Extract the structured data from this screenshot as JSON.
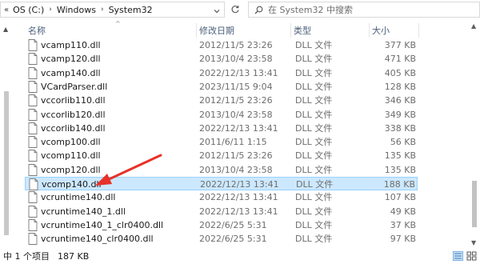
{
  "address": {
    "more_glyph": "«",
    "crumbs": [
      "OS (C:)",
      "Windows",
      "System32"
    ],
    "separator": "›"
  },
  "search": {
    "placeholder": "在 System32 中搜索"
  },
  "columns": {
    "name": "名称",
    "date": "修改日期",
    "type": "类型",
    "size": "大小"
  },
  "files": [
    {
      "name": "vcamp110.dll",
      "date": "2012/11/5 23:26",
      "type": "DLL 文件",
      "size": "377 KB"
    },
    {
      "name": "vcamp120.dll",
      "date": "2013/10/4 23:58",
      "type": "DLL 文件",
      "size": "471 KB"
    },
    {
      "name": "vcamp140.dll",
      "date": "2022/12/13 13:41",
      "type": "DLL 文件",
      "size": "405 KB"
    },
    {
      "name": "VCardParser.dll",
      "date": "2023/11/15 9:04",
      "type": "DLL 文件",
      "size": "128 KB"
    },
    {
      "name": "vccorlib110.dll",
      "date": "2012/11/5 23:26",
      "type": "DLL 文件",
      "size": "346 KB"
    },
    {
      "name": "vccorlib120.dll",
      "date": "2013/10/4 23:58",
      "type": "DLL 文件",
      "size": "349 KB"
    },
    {
      "name": "vccorlib140.dll",
      "date": "2022/12/13 13:41",
      "type": "DLL 文件",
      "size": "338 KB"
    },
    {
      "name": "vcomp100.dll",
      "date": "2011/6/11 1:15",
      "type": "DLL 文件",
      "size": "56 KB"
    },
    {
      "name": "vcomp110.dll",
      "date": "2012/11/5 23:26",
      "type": "DLL 文件",
      "size": "135 KB"
    },
    {
      "name": "vcomp120.dll",
      "date": "2013/10/4 23:58",
      "type": "DLL 文件",
      "size": "135 KB"
    },
    {
      "name": "vcomp140.dll",
      "date": "2022/12/13 13:41",
      "type": "DLL 文件",
      "size": "188 KB"
    },
    {
      "name": "vcruntime140.dll",
      "date": "2022/12/13 13:41",
      "type": "DLL 文件",
      "size": "107 KB"
    },
    {
      "name": "vcruntime140_1.dll",
      "date": "2022/12/13 13:41",
      "type": "DLL 文件",
      "size": "49 KB"
    },
    {
      "name": "vcruntime140_1_clr0400.dll",
      "date": "2022/6/25 5:31",
      "type": "DLL 文件",
      "size": "37 KB"
    },
    {
      "name": "vcruntime140_clr0400.dll",
      "date": "2022/6/25 5:31",
      "type": "DLL 文件",
      "size": "97 KB"
    }
  ],
  "selected_index": 10,
  "status": {
    "count": "中 1 个项目",
    "size": "187 KB"
  },
  "colors": {
    "selected_bg": "#cce8ff",
    "selected_border": "#99d1ff",
    "header_text": "#4c607a",
    "annotation_arrow": "#e8322a"
  },
  "icons": {
    "refresh": "refresh-icon",
    "search": "search-icon",
    "file": "dll-file-icon",
    "details_view": "details-view-icon",
    "tiles_view": "large-icons-view-icon"
  }
}
